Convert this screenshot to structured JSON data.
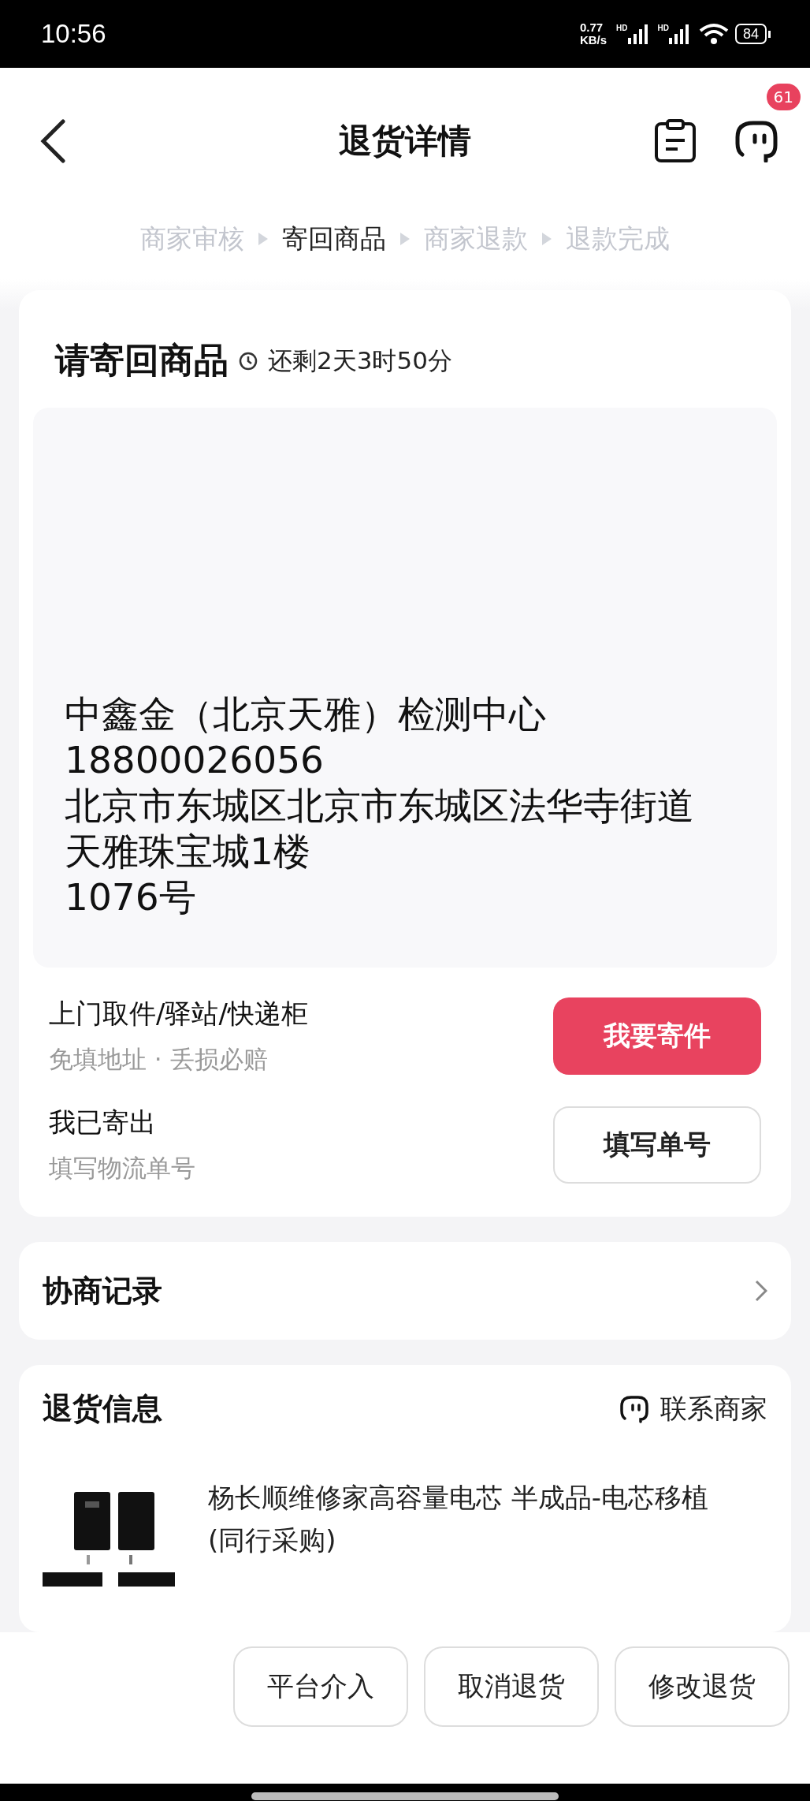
{
  "status_bar": {
    "time": "10:56",
    "net_speed": "0.77",
    "net_unit": "KB/s",
    "sim_labels": [
      "HD",
      "HD"
    ],
    "battery": "84"
  },
  "header": {
    "title": "退货详情",
    "message_badge": "61"
  },
  "steps": [
    {
      "label": "商家审核",
      "selected": false
    },
    {
      "label": "寄回商品",
      "selected": true
    },
    {
      "label": "商家退款",
      "selected": false
    },
    {
      "label": "退款完成",
      "selected": false
    }
  ],
  "return_card": {
    "title": "请寄回商品",
    "countdown": "还剩2天3时50分",
    "address_lines": [
      "中鑫金（北京天雅）检测中心",
      "18800026056",
      "北京市东城区北京市东城区法华寺街道天雅珠宝城1楼",
      "1076号"
    ],
    "options": [
      {
        "title": "上门取件/驿站/快递柜",
        "subtitle": "免填地址 · 丢损必赔",
        "button": "我要寄件",
        "kind": "primary"
      },
      {
        "title": "我已寄出",
        "subtitle": "填写物流单号",
        "button": "填写单号",
        "kind": "outline"
      }
    ]
  },
  "negotiation": {
    "title": "协商记录"
  },
  "return_info": {
    "title": "退货信息",
    "contact": "联系商家",
    "product": {
      "title": "杨长顺维修家高容量电芯 半成品-电芯移植(同行采购)"
    }
  },
  "bottom_buttons": [
    "平台介入",
    "取消退货",
    "修改退货"
  ]
}
